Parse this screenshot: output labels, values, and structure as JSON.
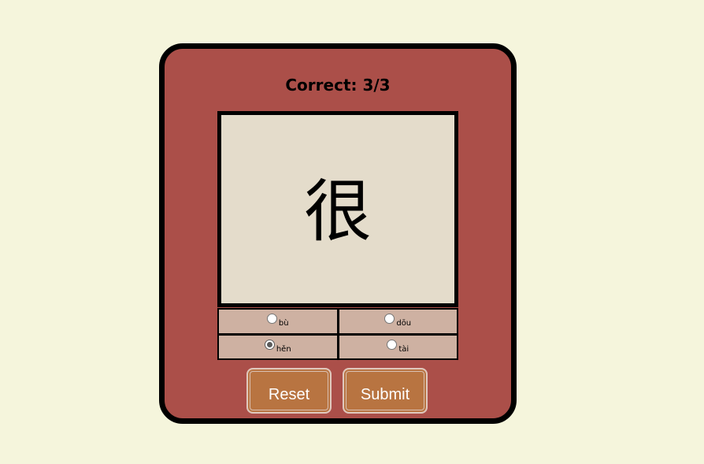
{
  "score": {
    "text": "Correct: 3/3"
  },
  "character": "很",
  "options": [
    {
      "label": "bù",
      "selected": false
    },
    {
      "label": "dōu",
      "selected": false
    },
    {
      "label": "hěn",
      "selected": true
    },
    {
      "label": "tài",
      "selected": false
    }
  ],
  "buttons": {
    "reset_label": "Reset",
    "submit_label": "Submit"
  },
  "colors": {
    "page_background": "#f5f5dc",
    "card_background": "#ab4f49",
    "character_box_background": "#e4dccb",
    "option_background": "#ceb1a2",
    "button_background": "#b87441"
  }
}
